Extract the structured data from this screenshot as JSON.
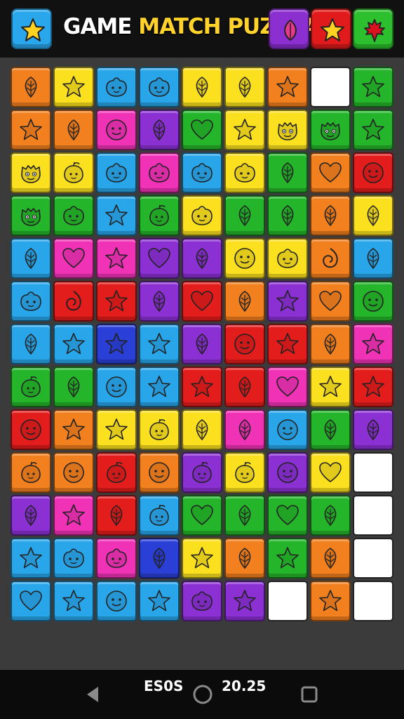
{
  "header": {
    "title_part1": "GAME",
    "title_part2": "MATCH PUZZLA",
    "left_button": {
      "color": "#2aa7ec",
      "icon": "star"
    },
    "right_buttons": [
      {
        "color": "#8b2fd1",
        "icon": "leaf"
      },
      {
        "color": "#e11b1b",
        "icon": "star"
      },
      {
        "color": "#2cbf2e",
        "icon": "leaf"
      }
    ]
  },
  "palette": {
    "O": "#f2801e",
    "Y": "#fbe020",
    "B": "#29a6ea",
    "R": "#e31c1c",
    "G": "#25b52a",
    "P": "#8b30d3",
    "K": "#f032b7",
    "D": "#2a3fd6",
    "W": "#ffffff"
  },
  "grid_rows": [
    "OO:leaf YO:star BO:blob BO:blob YO:leaf YO:leaf OO:star WO:none GO:star",
    "OO:star OO:leaf KO:face PO:leaf GO:heart YO:star YO:monster GO:monster GO:star",
    "YO:monster YO:fruit BO:blob KO:blob BO:blob YO:blob GO:leaf OO:heart RO:face",
    "GO:monster GO:blob BO:star GO:fruit YO:blob GO:leaf GO:leaf OO:leaf YO:leaf",
    "BO:leaf KO:heart KO:star PO:heart PO:leaf YO:face YO:blob OO:swirl BO:leaf",
    "BO:blob RO:swirl RO:star PO:leaf RO:heart OO:leaf PO:star OO:heart GO:face",
    "BO:leaf BO:star DO:star BO:star PO:leaf RO:face RO:star OO:leaf KO:star",
    "GO:fruit GO:leaf BO:face BO:star RO:star RO:leaf KO:heart YO:star RO:star",
    "RO:face OO:star YO:star YO:fruit YO:leaf KO:leaf BO:face GO:leaf PO:leaf",
    "OO:fruit OO:face RO:fruit OO:face PO:fruit YO:fruit PO:face YO:heart WO:none",
    "PO:leaf KO:star RO:leaf BO:fruit GO:heart GO:leaf GO:heart GO:leaf WO:none",
    "BO:star BO:blob KO:blob DO:leaf YO:star OO:leaf GO:star OO:leaf WO:none",
    "BO:heart BO:star BO:face BO:star PO:blob PO:star WO:none OO:star WO:none"
  ],
  "icon_colors": {
    "O": {
      "leaf": "#c34ad9"
    }
  },
  "status": {
    "score": "ES0S",
    "time": "20.25"
  }
}
